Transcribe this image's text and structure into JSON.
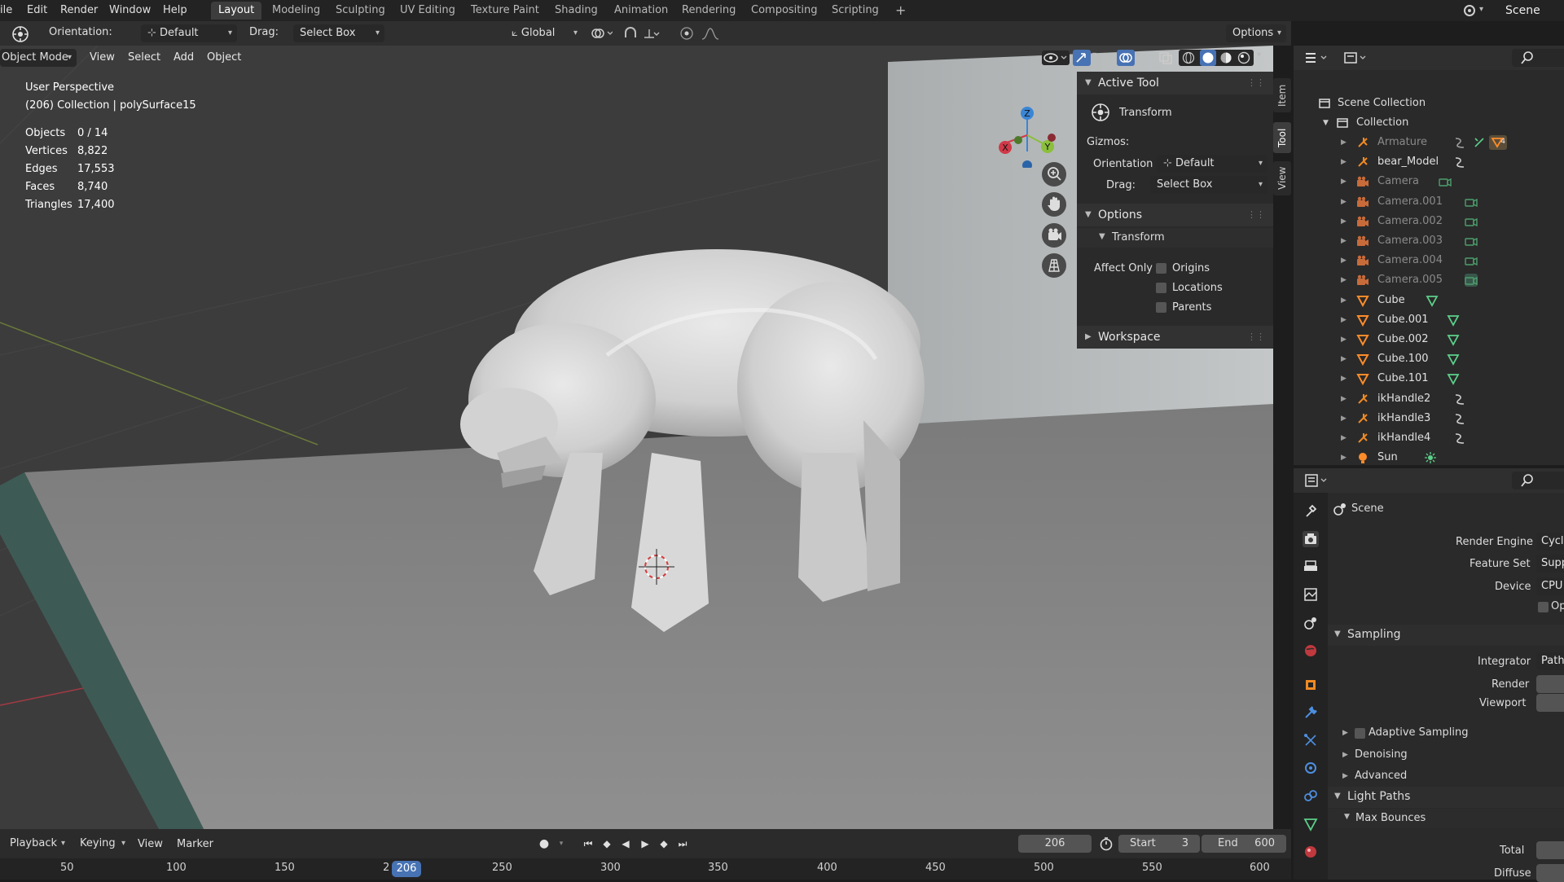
{
  "topbar": {
    "menus": [
      "ile",
      "Edit",
      "Render",
      "Window",
      "Help"
    ],
    "tabs": [
      {
        "label": "Layout",
        "active": true
      },
      {
        "label": "Modeling"
      },
      {
        "label": "Sculpting"
      },
      {
        "label": "UV Editing"
      },
      {
        "label": "Texture Paint"
      },
      {
        "label": "Shading"
      },
      {
        "label": "Animation"
      },
      {
        "label": "Rendering"
      },
      {
        "label": "Compositing"
      },
      {
        "label": "Scripting"
      }
    ],
    "add_tab": "+",
    "scene_name": "Scene"
  },
  "tool_header": {
    "orientation_label": "Orientation:",
    "orientation_value": "Default",
    "drag_label": "Drag:",
    "drag_value": "Select Box",
    "transform_space": "Global",
    "options_label": "Options"
  },
  "viewport": {
    "mode": "Object Mode",
    "menu": [
      "View",
      "Select",
      "Add",
      "Object"
    ],
    "perspective": "User Perspective",
    "collection_info": "(206) Collection | polySurface15",
    "stats": [
      {
        "label": "Objects",
        "value": "0 / 14"
      },
      {
        "label": "Vertices",
        "value": "8,822"
      },
      {
        "label": "Edges",
        "value": "17,553"
      },
      {
        "label": "Faces",
        "value": "8,740"
      },
      {
        "label": "Triangles",
        "value": "17,400"
      }
    ],
    "gizmo": {
      "x": "X",
      "y": "Y",
      "z": "Z"
    }
  },
  "npanel": {
    "tabs": [
      "Item",
      "Tool",
      "View"
    ],
    "active_tool_header": "Active Tool",
    "active_tool_name": "Transform",
    "gizmos_label": "Gizmos:",
    "orientation_label": "Orientation",
    "orientation_value": "Default",
    "drag_label": "Drag:",
    "drag_value": "Select Box",
    "options_header": "Options",
    "transform_sub": "Transform",
    "affect_only": "Affect Only",
    "checks": [
      "Origins",
      "Locations",
      "Parents"
    ],
    "workspace_header": "Workspace"
  },
  "outliner": {
    "scene_collection": "Scene Collection",
    "collection": "Collection",
    "items": [
      {
        "name": "Armature",
        "type": "armature",
        "dim": true
      },
      {
        "name": "bear_Model",
        "type": "armature",
        "dim": false
      },
      {
        "name": "Camera",
        "type": "camera",
        "dim": true
      },
      {
        "name": "Camera.001",
        "type": "camera",
        "dim": true
      },
      {
        "name": "Camera.002",
        "type": "camera",
        "dim": true
      },
      {
        "name": "Camera.003",
        "type": "camera",
        "dim": true
      },
      {
        "name": "Camera.004",
        "type": "camera",
        "dim": true
      },
      {
        "name": "Camera.005",
        "type": "camera",
        "dim": true
      },
      {
        "name": "Cube",
        "type": "mesh",
        "dim": false
      },
      {
        "name": "Cube.001",
        "type": "mesh",
        "dim": false
      },
      {
        "name": "Cube.002",
        "type": "mesh",
        "dim": false
      },
      {
        "name": "Cube.100",
        "type": "mesh",
        "dim": false
      },
      {
        "name": "Cube.101",
        "type": "mesh",
        "dim": false
      },
      {
        "name": "ikHandle2",
        "type": "armature",
        "dim": false
      },
      {
        "name": "ikHandle3",
        "type": "armature",
        "dim": false
      },
      {
        "name": "ikHandle4",
        "type": "armature",
        "dim": false
      },
      {
        "name": "Sun",
        "type": "light",
        "dim": false
      }
    ],
    "armature_badge": "4"
  },
  "properties": {
    "context": "Scene",
    "render_engine_label": "Render Engine",
    "render_engine_value": "Cycl",
    "feature_set_label": "Feature Set",
    "feature_set_value": "Supp",
    "device_label": "Device",
    "device_value": "CPU",
    "open_shading": "Op",
    "sampling": "Sampling",
    "integrator_label": "Integrator",
    "integrator_value": "Path",
    "render_label": "Render",
    "viewport_label": "Viewport",
    "adaptive_sampling": "Adaptive Sampling",
    "denoising": "Denoising",
    "advanced": "Advanced",
    "light_paths": "Light Paths",
    "max_bounces": "Max Bounces",
    "total_label": "Total",
    "diffuse_label": "Diffuse"
  },
  "timeline": {
    "menus": [
      "Playback",
      "Keying",
      "View",
      "Marker"
    ],
    "current_frame": "206",
    "start_label": "Start",
    "start_value": "3",
    "end_label": "End",
    "end_value": "600",
    "ticks": [
      "50",
      "100",
      "150",
      "2",
      "250",
      "300",
      "350",
      "400",
      "450",
      "500",
      "550",
      "600"
    ],
    "playhead": "206"
  },
  "colors": {
    "accent": "#4772b3",
    "x_axis": "#d03a48",
    "y_axis": "#8bbf3c",
    "z_axis": "#3a86d6",
    "camera": "#c86b3a",
    "mesh": "#ff8c2a",
    "data_green": "#5cd08a"
  }
}
